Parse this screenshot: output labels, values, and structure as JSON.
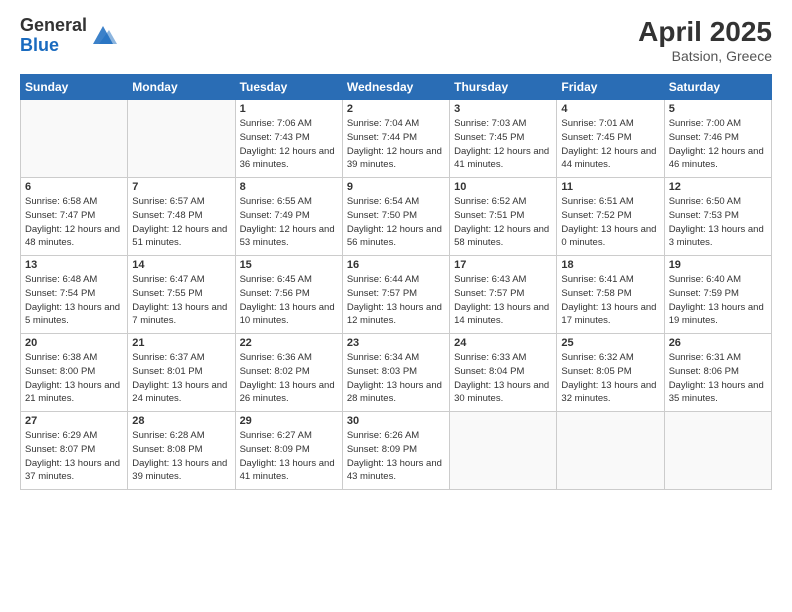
{
  "logo": {
    "general": "General",
    "blue": "Blue"
  },
  "header": {
    "month_year": "April 2025",
    "location": "Batsion, Greece"
  },
  "weekdays": [
    "Sunday",
    "Monday",
    "Tuesday",
    "Wednesday",
    "Thursday",
    "Friday",
    "Saturday"
  ],
  "weeks": [
    [
      {
        "day": "",
        "info": ""
      },
      {
        "day": "",
        "info": ""
      },
      {
        "day": "1",
        "info": "Sunrise: 7:06 AM\nSunset: 7:43 PM\nDaylight: 12 hours and 36 minutes."
      },
      {
        "day": "2",
        "info": "Sunrise: 7:04 AM\nSunset: 7:44 PM\nDaylight: 12 hours and 39 minutes."
      },
      {
        "day": "3",
        "info": "Sunrise: 7:03 AM\nSunset: 7:45 PM\nDaylight: 12 hours and 41 minutes."
      },
      {
        "day": "4",
        "info": "Sunrise: 7:01 AM\nSunset: 7:45 PM\nDaylight: 12 hours and 44 minutes."
      },
      {
        "day": "5",
        "info": "Sunrise: 7:00 AM\nSunset: 7:46 PM\nDaylight: 12 hours and 46 minutes."
      }
    ],
    [
      {
        "day": "6",
        "info": "Sunrise: 6:58 AM\nSunset: 7:47 PM\nDaylight: 12 hours and 48 minutes."
      },
      {
        "day": "7",
        "info": "Sunrise: 6:57 AM\nSunset: 7:48 PM\nDaylight: 12 hours and 51 minutes."
      },
      {
        "day": "8",
        "info": "Sunrise: 6:55 AM\nSunset: 7:49 PM\nDaylight: 12 hours and 53 minutes."
      },
      {
        "day": "9",
        "info": "Sunrise: 6:54 AM\nSunset: 7:50 PM\nDaylight: 12 hours and 56 minutes."
      },
      {
        "day": "10",
        "info": "Sunrise: 6:52 AM\nSunset: 7:51 PM\nDaylight: 12 hours and 58 minutes."
      },
      {
        "day": "11",
        "info": "Sunrise: 6:51 AM\nSunset: 7:52 PM\nDaylight: 13 hours and 0 minutes."
      },
      {
        "day": "12",
        "info": "Sunrise: 6:50 AM\nSunset: 7:53 PM\nDaylight: 13 hours and 3 minutes."
      }
    ],
    [
      {
        "day": "13",
        "info": "Sunrise: 6:48 AM\nSunset: 7:54 PM\nDaylight: 13 hours and 5 minutes."
      },
      {
        "day": "14",
        "info": "Sunrise: 6:47 AM\nSunset: 7:55 PM\nDaylight: 13 hours and 7 minutes."
      },
      {
        "day": "15",
        "info": "Sunrise: 6:45 AM\nSunset: 7:56 PM\nDaylight: 13 hours and 10 minutes."
      },
      {
        "day": "16",
        "info": "Sunrise: 6:44 AM\nSunset: 7:57 PM\nDaylight: 13 hours and 12 minutes."
      },
      {
        "day": "17",
        "info": "Sunrise: 6:43 AM\nSunset: 7:57 PM\nDaylight: 13 hours and 14 minutes."
      },
      {
        "day": "18",
        "info": "Sunrise: 6:41 AM\nSunset: 7:58 PM\nDaylight: 13 hours and 17 minutes."
      },
      {
        "day": "19",
        "info": "Sunrise: 6:40 AM\nSunset: 7:59 PM\nDaylight: 13 hours and 19 minutes."
      }
    ],
    [
      {
        "day": "20",
        "info": "Sunrise: 6:38 AM\nSunset: 8:00 PM\nDaylight: 13 hours and 21 minutes."
      },
      {
        "day": "21",
        "info": "Sunrise: 6:37 AM\nSunset: 8:01 PM\nDaylight: 13 hours and 24 minutes."
      },
      {
        "day": "22",
        "info": "Sunrise: 6:36 AM\nSunset: 8:02 PM\nDaylight: 13 hours and 26 minutes."
      },
      {
        "day": "23",
        "info": "Sunrise: 6:34 AM\nSunset: 8:03 PM\nDaylight: 13 hours and 28 minutes."
      },
      {
        "day": "24",
        "info": "Sunrise: 6:33 AM\nSunset: 8:04 PM\nDaylight: 13 hours and 30 minutes."
      },
      {
        "day": "25",
        "info": "Sunrise: 6:32 AM\nSunset: 8:05 PM\nDaylight: 13 hours and 32 minutes."
      },
      {
        "day": "26",
        "info": "Sunrise: 6:31 AM\nSunset: 8:06 PM\nDaylight: 13 hours and 35 minutes."
      }
    ],
    [
      {
        "day": "27",
        "info": "Sunrise: 6:29 AM\nSunset: 8:07 PM\nDaylight: 13 hours and 37 minutes."
      },
      {
        "day": "28",
        "info": "Sunrise: 6:28 AM\nSunset: 8:08 PM\nDaylight: 13 hours and 39 minutes."
      },
      {
        "day": "29",
        "info": "Sunrise: 6:27 AM\nSunset: 8:09 PM\nDaylight: 13 hours and 41 minutes."
      },
      {
        "day": "30",
        "info": "Sunrise: 6:26 AM\nSunset: 8:09 PM\nDaylight: 13 hours and 43 minutes."
      },
      {
        "day": "",
        "info": ""
      },
      {
        "day": "",
        "info": ""
      },
      {
        "day": "",
        "info": ""
      }
    ]
  ]
}
